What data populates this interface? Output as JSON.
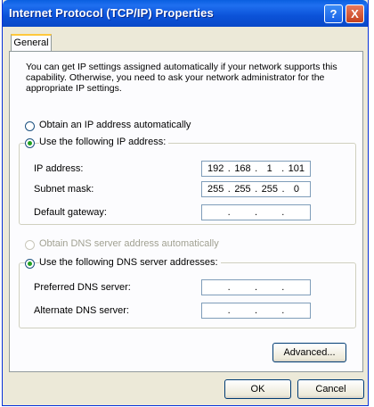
{
  "window": {
    "title": "Internet Protocol (TCP/IP) Properties",
    "help_button": "?",
    "close_button": "X"
  },
  "tabs": [
    "General"
  ],
  "description": "You can get IP settings assigned automatically if your network supports this capability. Otherwise, you need to ask your network administrator for the appropriate IP settings.",
  "ip": {
    "option_auto": "Obtain an IP address automatically",
    "option_manual": "Use the following IP address:",
    "selected": "manual",
    "ip_address_label": "IP address:",
    "ip_address": [
      "192",
      "168",
      "1",
      "101"
    ],
    "subnet_label": "Subnet mask:",
    "subnet": [
      "255",
      "255",
      "255",
      "0"
    ],
    "gateway_label": "Default gateway:",
    "gateway": [
      "",
      "",
      "",
      ""
    ]
  },
  "dns": {
    "option_auto": "Obtain DNS server address automatically",
    "option_manual": "Use the following DNS server addresses:",
    "selected": "manual",
    "auto_disabled": true,
    "preferred_label": "Preferred DNS server:",
    "preferred": [
      "",
      "",
      "",
      ""
    ],
    "alternate_label": "Alternate DNS server:",
    "alternate": [
      "",
      "",
      "",
      ""
    ]
  },
  "buttons": {
    "advanced": "Advanced...",
    "ok": "OK",
    "cancel": "Cancel"
  },
  "colors": {
    "titlebar": "#0b52d8",
    "dialog_bg": "#ece9d8",
    "radio_check": "#21a121"
  }
}
